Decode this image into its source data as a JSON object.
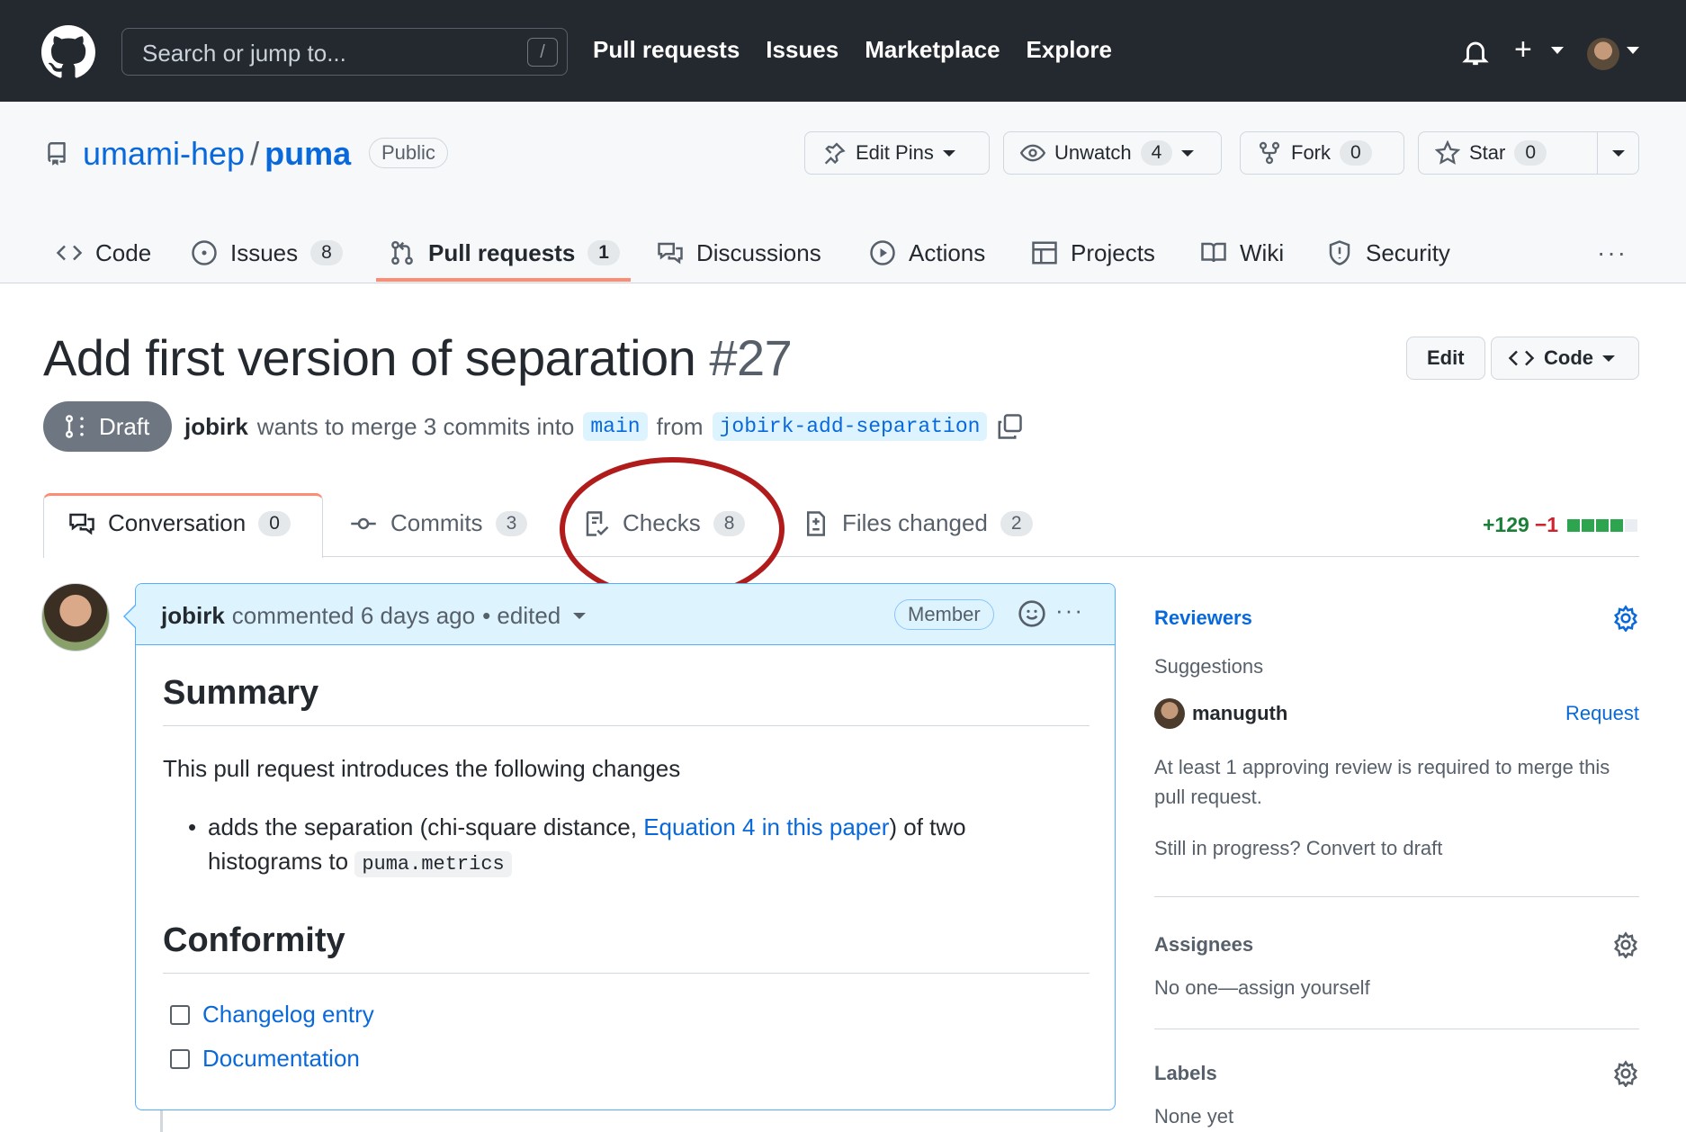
{
  "header": {
    "search_placeholder": "Search or jump to...",
    "search_shortcut": "/",
    "nav": [
      "Pull requests",
      "Issues",
      "Marketplace",
      "Explore"
    ],
    "plus_label": "+"
  },
  "repo": {
    "owner": "umami-hep",
    "separator": "/",
    "name": "puma",
    "visibility": "Public",
    "buttons": {
      "edit_pins": "Edit Pins",
      "unwatch": "Unwatch",
      "unwatch_count": "4",
      "fork": "Fork",
      "fork_count": "0",
      "star": "Star",
      "star_count": "0"
    },
    "nav": {
      "code": "Code",
      "issues": "Issues",
      "issues_count": "8",
      "pull_requests": "Pull requests",
      "pull_requests_count": "1",
      "discussions": "Discussions",
      "actions": "Actions",
      "projects": "Projects",
      "wiki": "Wiki",
      "security": "Security",
      "more": "···"
    }
  },
  "pr": {
    "title": "Add first version of separation",
    "number": "#27",
    "edit_label": "Edit",
    "code_label": "Code",
    "state": "Draft",
    "author": "jobirk",
    "merge_text_1": "wants to merge 3 commits into",
    "base_branch": "main",
    "merge_text_2": "from",
    "head_branch": "jobirk-add-separation",
    "tabs": {
      "conversation": "Conversation",
      "conversation_count": "0",
      "commits": "Commits",
      "commits_count": "3",
      "checks": "Checks",
      "checks_count": "8",
      "files": "Files changed",
      "files_count": "2"
    },
    "diffstat": {
      "additions": "+129",
      "deletions": "−1"
    }
  },
  "comment": {
    "author": "jobirk",
    "meta": "commented 6 days ago",
    "edited": "• edited",
    "role": "Member",
    "more": "···",
    "summary_heading": "Summary",
    "summary_text": "This pull request introduces the following changes",
    "bullet_pre": "adds the separation (chi-square distance,",
    "bullet_link": "Equation 4 in this paper",
    "bullet_post": ") of two histograms to",
    "bullet_code": "puma.metrics",
    "conformity_heading": "Conformity",
    "checklist": [
      "Changelog entry",
      "Documentation"
    ]
  },
  "sidebar": {
    "reviewers_title": "Reviewers",
    "suggestions_label": "Suggestions",
    "suggested_reviewer": "manuguth",
    "request_label": "Request",
    "approval_note": "At least 1 approving review is required to merge this pull request.",
    "convert_note": "Still in progress? Convert to draft",
    "assignees_title": "Assignees",
    "assignees_value": "No one—assign yourself",
    "labels_title": "Labels",
    "labels_value": "None yet"
  },
  "colors": {
    "header_bg": "#24292f",
    "link": "#0969da",
    "tab_accent": "#fd8c73",
    "annotation": "#b01c1c",
    "addition": "#1a7f37",
    "deletion": "#cf222e"
  }
}
